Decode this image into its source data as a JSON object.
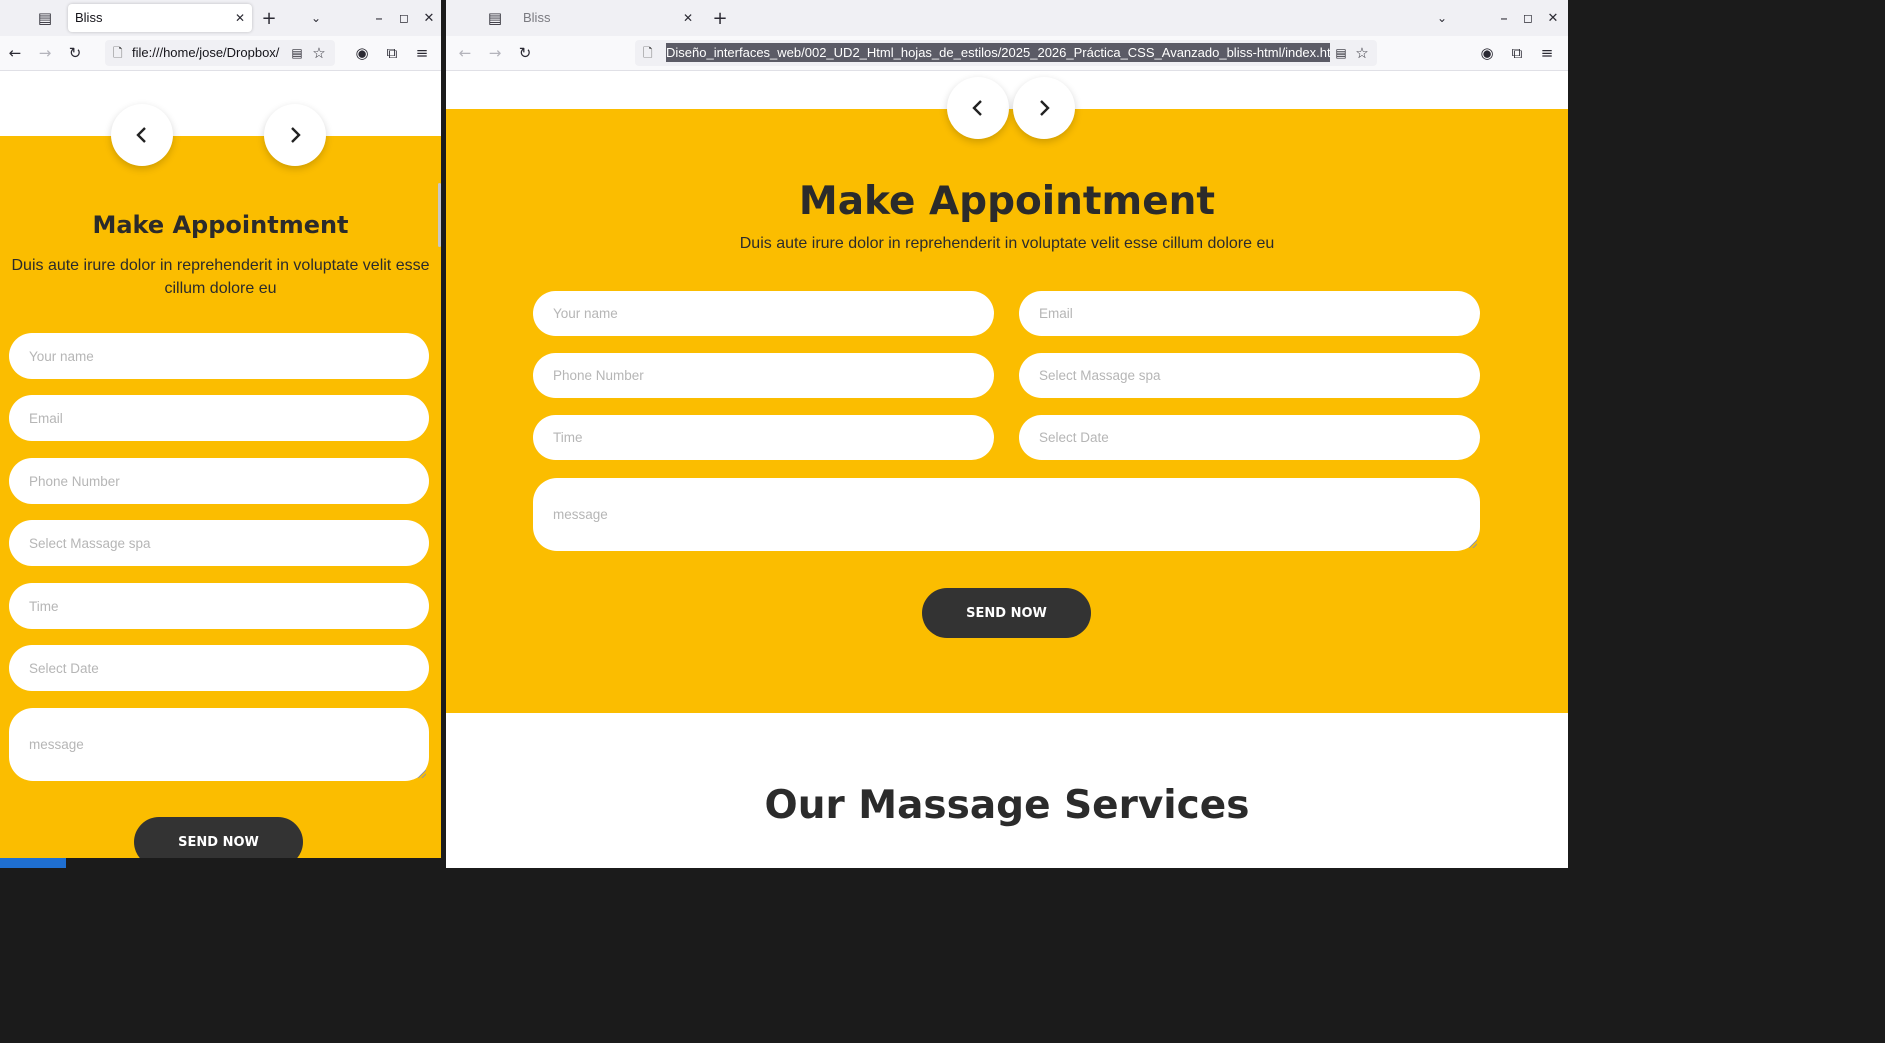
{
  "left_window": {
    "tab_title": "Bliss",
    "url": "file:///home/jose/Dropbox/"
  },
  "right_window": {
    "tab_title": "Bliss",
    "url_path": "Diseño_interfaces_web/002_UD2_Html_hojas_de_estilos/2025_2026_Práctica_CSS_Avanzado_bliss-html/index.html"
  },
  "appointment": {
    "title": "Make Appointment",
    "subtitle": "Duis aute irure dolor in reprehenderit in voluptate velit esse cillum dolore eu",
    "fields": {
      "name": "Your name",
      "email": "Email",
      "phone": "Phone Number",
      "massage": "Select Massage spa",
      "time": "Time",
      "date": "Select Date",
      "message": "message"
    },
    "send_label": "SEND NOW"
  },
  "services": {
    "title": "Our Massage Services"
  },
  "icons": [
    "tab-list-icon",
    "close-icon",
    "new-tab-icon",
    "tab-overflow-icon",
    "minimize-icon",
    "maximize-icon",
    "window-close-icon",
    "back-icon",
    "forward-icon",
    "reload-icon",
    "page-icon",
    "reader-view-icon",
    "bookmark-star-icon",
    "account-icon",
    "extensions-icon",
    "menu-icon",
    "chevron-left-icon",
    "chevron-right-icon"
  ],
  "colors": {
    "accent_yellow": "#fbbd00",
    "button_dark": "#333333",
    "text_dark": "#2b2b2b",
    "placeholder": "#b6b6b6"
  }
}
